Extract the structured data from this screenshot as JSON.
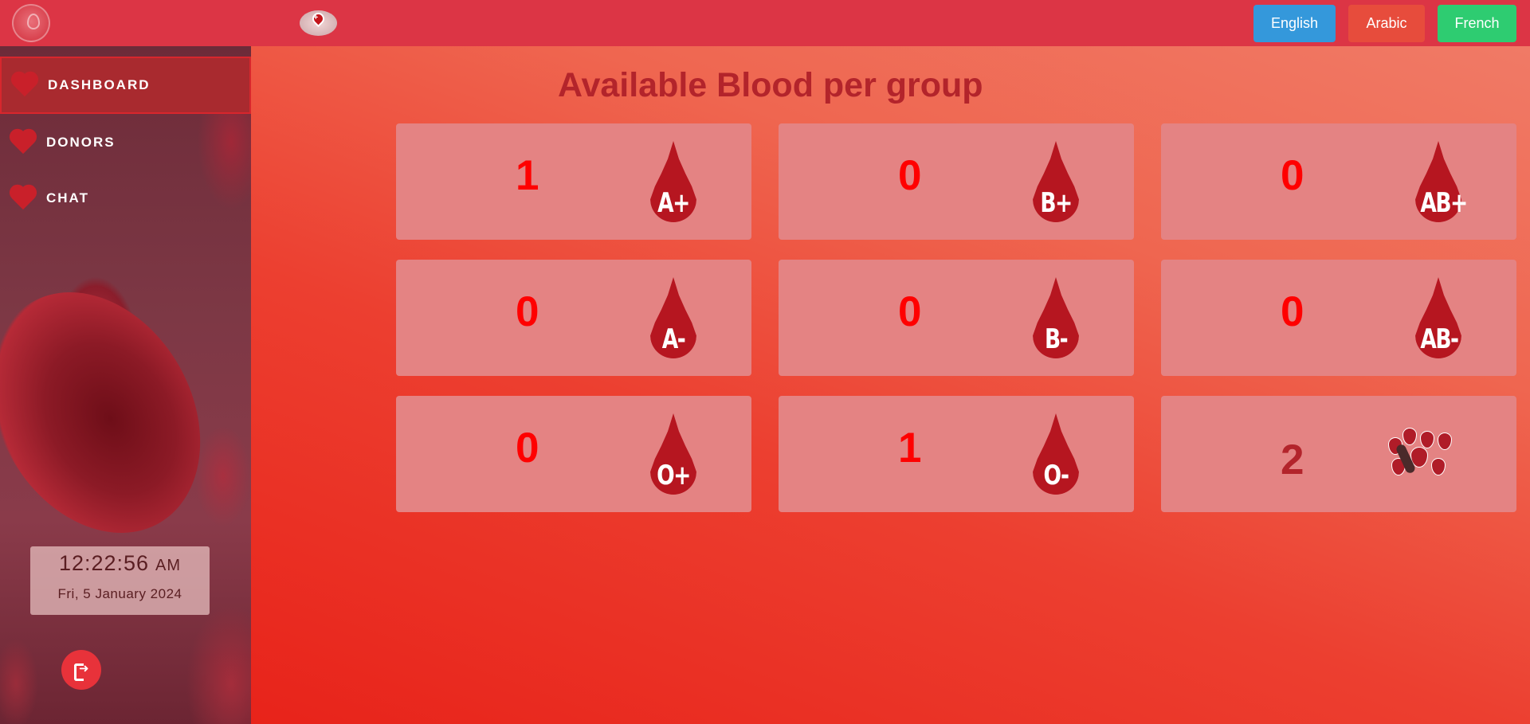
{
  "header": {
    "languages": [
      {
        "label": "English",
        "color": "#3498db"
      },
      {
        "label": "Arabic",
        "color": "#e74c3c"
      },
      {
        "label": "French",
        "color": "#2ecc71"
      }
    ]
  },
  "sidebar": {
    "items": [
      {
        "label": "DASHBOARD",
        "icon": "heart-icon",
        "active": true
      },
      {
        "label": "DONORS",
        "icon": "heart-icon",
        "active": false
      },
      {
        "label": "CHAT",
        "icon": "heart-icon",
        "active": false
      }
    ],
    "clock": {
      "time": "12:22:56",
      "meridiem": "AM",
      "date": "Fri, 5 January 2024"
    },
    "logout_icon": "sign-out-icon"
  },
  "main": {
    "title": "Available Blood per group",
    "groups": [
      {
        "group": "A+",
        "count": "1"
      },
      {
        "group": "B+",
        "count": "0"
      },
      {
        "group": "AB+",
        "count": "0"
      },
      {
        "group": "A-",
        "count": "0"
      },
      {
        "group": "B-",
        "count": "0"
      },
      {
        "group": "AB-",
        "count": "0"
      },
      {
        "group": "O+",
        "count": "0"
      },
      {
        "group": "O-",
        "count": "1"
      }
    ],
    "total": {
      "count": "2",
      "icon": "blood-drops-icon"
    }
  },
  "colors": {
    "topbar": "#dc3545",
    "card": "#e48383",
    "count": "#ff0000",
    "drop": "#b61620",
    "title": "#b3242b"
  }
}
